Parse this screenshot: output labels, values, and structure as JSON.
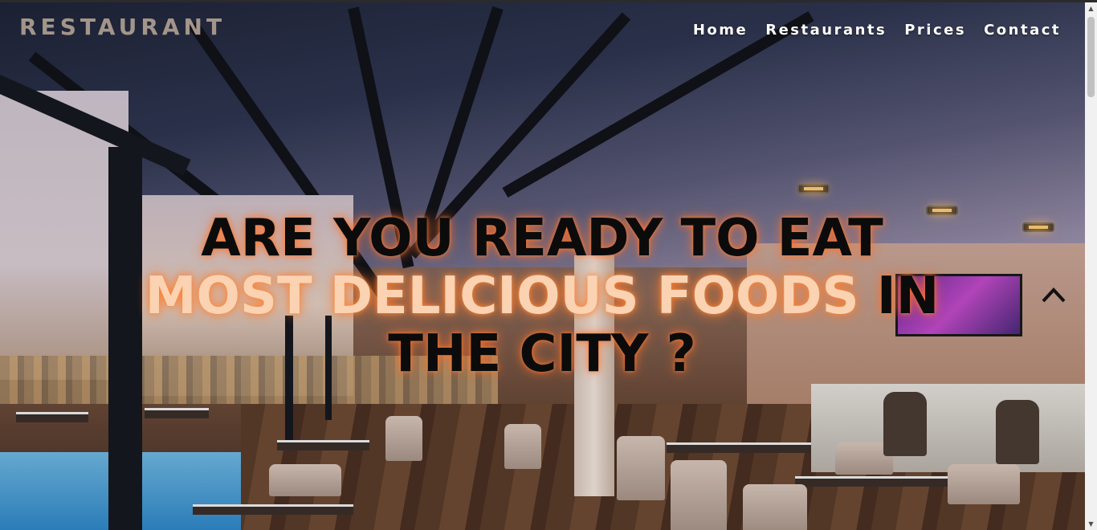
{
  "brand": {
    "name": "RESTAURANT"
  },
  "nav": {
    "items": [
      {
        "label": "Home"
      },
      {
        "label": "Restaurants"
      },
      {
        "label": "Prices"
      },
      {
        "label": "Contact"
      }
    ]
  },
  "hero": {
    "line1": "ARE YOU READY TO EAT",
    "line2_accent": "MOST DELICIOUS FOODS",
    "line2_rest": " IN",
    "line3": "THE CITY ?",
    "background_image": "restaurant-interior-photo",
    "scroll_up_icon": "caret-up-icon"
  },
  "colors": {
    "brand": "#a3958a",
    "nav_text": "#ffffff",
    "headline": "#0b0b0b",
    "accent": "#fbd3b2",
    "glow": "#ff7a30"
  }
}
